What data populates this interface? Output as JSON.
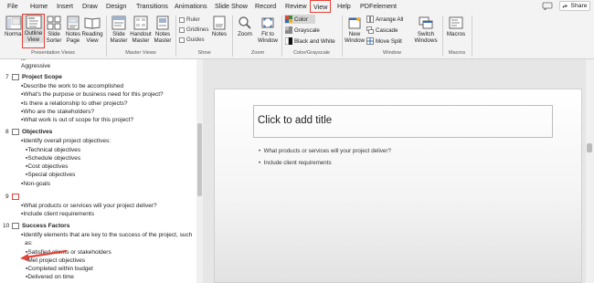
{
  "tabs": [
    "File",
    "Home",
    "Insert",
    "Draw",
    "Design",
    "Transitions",
    "Animations",
    "Slide Show",
    "Record",
    "Review",
    "View",
    "Help",
    "PDFelement"
  ],
  "active_tab": "View",
  "share_label": "Share",
  "ribbon": {
    "presentation_views": {
      "label": "Presentation Views",
      "normal": "Normal",
      "outline_view": [
        "Outline",
        "View"
      ],
      "slide_sorter": [
        "Slide",
        "Sorter"
      ],
      "notes_page": [
        "Notes",
        "Page"
      ],
      "reading_view": [
        "Reading",
        "View"
      ]
    },
    "master_views": {
      "label": "Master Views",
      "slide_master": [
        "Slide",
        "Master"
      ],
      "handout_master": [
        "Handout",
        "Master"
      ],
      "notes_master": [
        "Notes",
        "Master"
      ]
    },
    "show": {
      "label": "Show",
      "ruler": "Ruler",
      "gridlines": "Gridlines",
      "guides": "Guides",
      "notes": "Notes"
    },
    "zoom": {
      "label": "Zoom",
      "zoom": "Zoom",
      "fit_to_window": [
        "Fit to",
        "Window"
      ]
    },
    "color_grayscale": {
      "label": "Color/Grayscale",
      "color": "Color",
      "grayscale": "Grayscale",
      "black_and_white": "Black and White"
    },
    "window": {
      "label": "Window",
      "new_window": [
        "New",
        "Window"
      ],
      "arrange_all": "Arrange All",
      "cascade": "Cascade",
      "move_split": "Move Split",
      "switch_windows": [
        "Switch",
        "Windows"
      ]
    },
    "macros": {
      "label": "Macros",
      "macros": "Macros"
    }
  },
  "outline": {
    "top_partial_1": "is",
    "top_partial_2": "Aggressive",
    "slides": [
      {
        "num": "7",
        "title": "Project Scope",
        "bullets": [
          "Describe the work to be accomplished",
          "What's the purpose or business need for this project?",
          "Is there a relationship to other projects?",
          "Who are the stakeholders?",
          "What work is out of scope for this project?"
        ]
      },
      {
        "num": "8",
        "title": "Objectives",
        "bullets": [
          "Identify overall project objectives:"
        ],
        "sub_bullets": [
          "Technical objectives",
          "Schedule objectives",
          "Cost objectives",
          "Special objectives"
        ],
        "after_bullets": [
          "Non-goals"
        ]
      },
      {
        "num": "9",
        "title": "",
        "bullets": [
          "What products or services will your project deliver?",
          "Include client requirements"
        ]
      },
      {
        "num": "10",
        "title": "Success Factors",
        "bullets": [
          "Identify elements that are key to the success of the project, such",
          "as:"
        ],
        "sub_bullets": [
          "Satisfied clients or stakeholders",
          "Met project objectives",
          "Completed within budget",
          "Delivered on time"
        ]
      }
    ]
  },
  "slide": {
    "title_placeholder": "Click to add title",
    "bullets": [
      "What products or services will your project deliver?",
      "Include client requirements"
    ]
  },
  "colors": {
    "highlight": "#e0443a",
    "ribbon_bg": "#f3f3f3",
    "slide_bg": "#e6e6e6"
  }
}
